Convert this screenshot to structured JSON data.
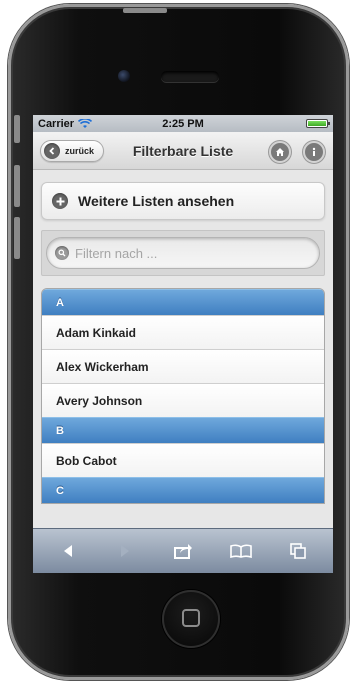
{
  "status_bar": {
    "carrier": "Carrier",
    "time": "2:25 PM",
    "wifi_icon": "wifi-icon",
    "battery_icon": "battery-icon",
    "battery_level": 1.0
  },
  "header": {
    "back_label": "zurück",
    "back_icon": "chevron-left-icon",
    "title": "Filterbare Liste",
    "home_icon": "home-icon",
    "info_icon": "info-icon"
  },
  "more_lists": {
    "label": "Weitere Listen ansehen",
    "icon": "plus-icon"
  },
  "filter": {
    "placeholder": "Filtern nach ...",
    "icon": "search-icon"
  },
  "list": {
    "sections": [
      {
        "divider": "A",
        "items": [
          "Adam Kinkaid",
          "Alex Wickerham",
          "Avery Johnson"
        ]
      },
      {
        "divider": "B",
        "items": [
          "Bob Cabot"
        ]
      },
      {
        "divider": "C",
        "items": []
      }
    ]
  },
  "toolbar": {
    "items": [
      "back-arrow-icon",
      "forward-arrow-icon",
      "share-icon",
      "bookmarks-icon",
      "tabs-icon"
    ]
  },
  "colors": {
    "list_divider": "#4f8fd1",
    "toolbar": "#8c9aae"
  }
}
